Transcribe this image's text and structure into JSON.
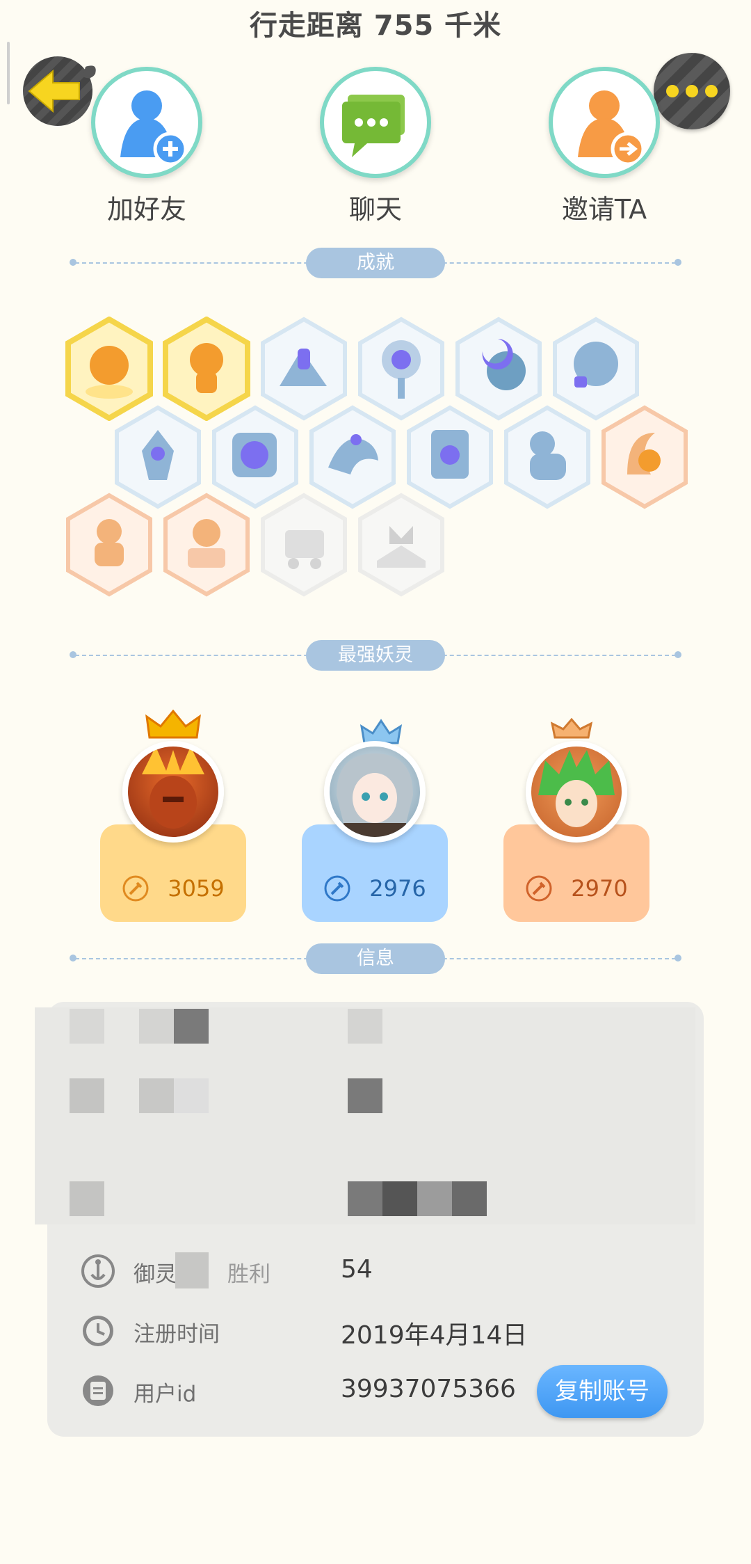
{
  "header": {
    "title": "行走距离 755 千米"
  },
  "actions": [
    {
      "label": "加好友",
      "icon": "add-friend-icon"
    },
    {
      "label": "聊天",
      "icon": "chat-icon"
    },
    {
      "label": "邀请TA",
      "icon": "invite-icon"
    }
  ],
  "sections": {
    "achievements": "成就",
    "strongest": "最强妖灵",
    "info": "信息"
  },
  "spirits": [
    {
      "score": "3059",
      "theme": "#ffd98a"
    },
    {
      "score": "2976",
      "theme": "#a9d4ff"
    },
    {
      "score": "2970",
      "theme": "#ffc79b"
    }
  ],
  "info": {
    "rows": [
      {
        "key": "御灵",
        "key_suffix": "胜利",
        "value": "54",
        "icon": "spirit-icon"
      },
      {
        "key": "注册时间",
        "value": "2019年4月14日",
        "icon": "clock-icon"
      },
      {
        "key": "用户id",
        "value": "39937075366",
        "icon": "id-card-icon"
      }
    ],
    "copy_button": "复制账号"
  }
}
